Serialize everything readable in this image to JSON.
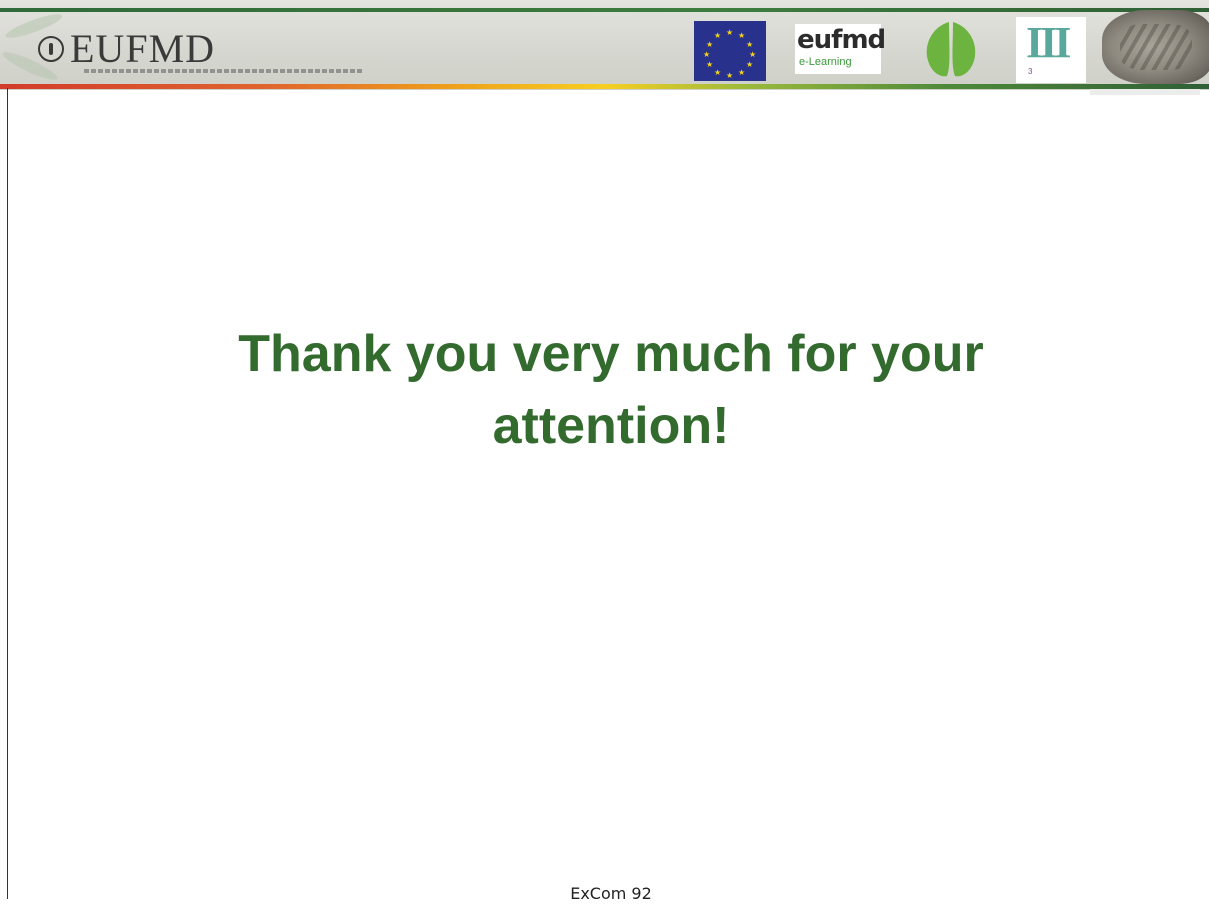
{
  "header": {
    "brand_text": "EUFMD",
    "logos": [
      "fao-emblem-icon",
      "eu-flag-logo",
      "eufmd-elearning-logo",
      "hoof-logo",
      "third-edition-logo",
      "stone-relief-logo"
    ],
    "elearning_logo": {
      "line1": "eufmd",
      "line2": "e-Learning"
    },
    "third_logo": {
      "roman": "III"
    }
  },
  "slide": {
    "title_line1": "Thank you very much for your",
    "title_line2": "attention!"
  },
  "footer": {
    "text": "ExCom 92"
  },
  "colors": {
    "title": "#336a2e",
    "header_bg": "#d5d6cf",
    "eu_blue": "#28318c",
    "eu_star": "#f2d21b",
    "hoof_green": "#6cb33f"
  }
}
